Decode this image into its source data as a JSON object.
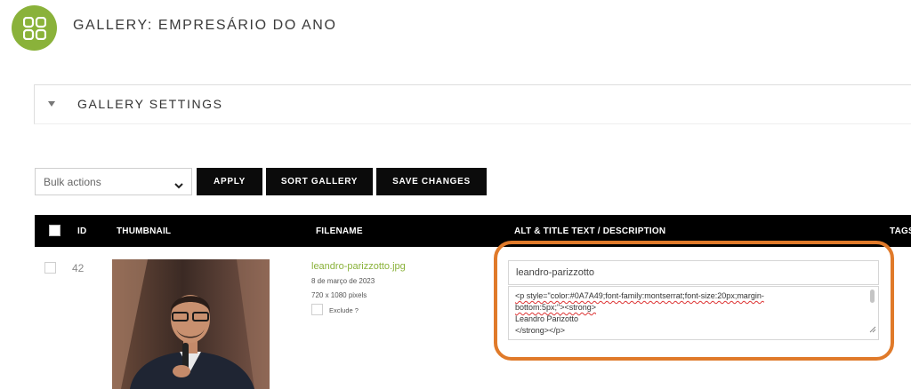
{
  "header": {
    "title": "GALLERY: EMPRESÁRIO DO ANO",
    "app_icon": "grid-icon",
    "accent_color": "#8ab23a"
  },
  "settings_panel": {
    "title": "GALLERY SETTINGS",
    "expand_icon": "triangle-down-icon"
  },
  "toolbar": {
    "bulk_actions_label": "Bulk actions",
    "apply_label": "APPLY",
    "sort_label": "SORT GALLERY",
    "save_label": "SAVE CHANGES"
  },
  "table": {
    "columns": {
      "id": "ID",
      "thumbnail": "THUMBNAIL",
      "filename": "FILENAME",
      "alt": "ALT & TITLE TEXT / DESCRIPTION",
      "tags": "TAGS"
    },
    "rows": [
      {
        "id": "42",
        "filename": "leandro-parizzotto.jpg",
        "date": "8 de março de 2023",
        "dimensions": "720 x 1080 pixels",
        "exclude_label": "Exclude ?",
        "alt_text": "leandro-parizzotto",
        "description_lines": [
          "<p style=\"color:#0A7A49;font-family:montserrat;font-size:20px;margin-",
          "bottom:5px;\"><strong>",
          "Leandro Parizotto",
          "</strong></p>"
        ]
      }
    ]
  },
  "highlight_color": "#e07a2a"
}
